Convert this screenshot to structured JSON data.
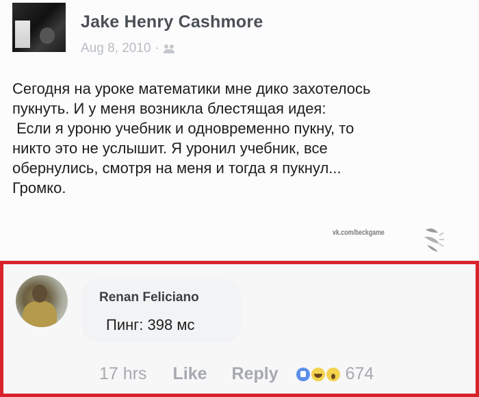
{
  "post": {
    "author": "Jake Henry Cashmore",
    "date": "Aug 8, 2010",
    "separator": "·",
    "text_lines": [
      "Сегодня на уроке математики мне дико захотелось",
      "пукнуть. И у меня возникла блестящая идея:",
      " Если я уроню учебник и одновременно пукну, то",
      "никто это не услышит. Я уронил учебник, все",
      "обернулись, смотря на меня и тогда я пукнул...",
      "Громко."
    ],
    "watermark": "vk.com/beckgame",
    "privacy_icon": "friends-icon"
  },
  "comment": {
    "author": "Renan Feliciano",
    "text": "Пинг: 398 мс",
    "time": "17 hrs",
    "like_label": "Like",
    "reply_label": "Reply",
    "reactions": [
      "like-reaction-icon",
      "haha-reaction-icon",
      "wow-reaction-icon"
    ],
    "reaction_count": "674",
    "highlight_color": "#d8232a"
  }
}
